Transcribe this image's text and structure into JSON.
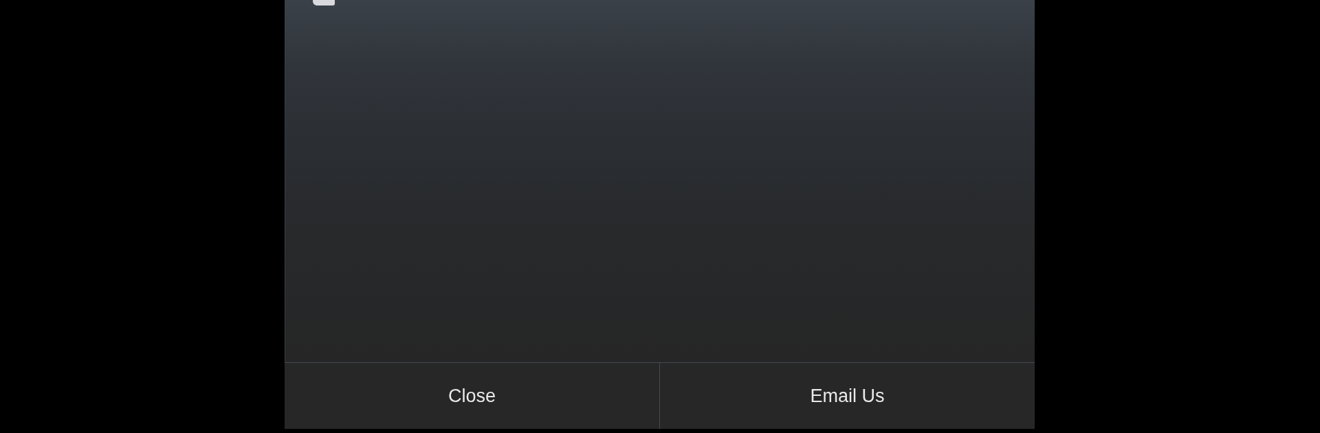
{
  "dialog": {
    "buttons": [
      "Close",
      "Email Us"
    ]
  }
}
